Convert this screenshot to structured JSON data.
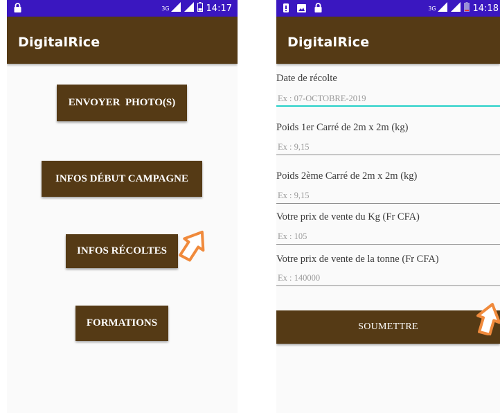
{
  "left_screen": {
    "status": {
      "network": "3G",
      "time": "14:17"
    },
    "app_title": "DigitalRice",
    "buttons": [
      {
        "label": "ENVOYER  PHOTO(S)"
      },
      {
        "label": "INFOS DÉBUT CAMPAGNE"
      },
      {
        "label": "INFOS RÉCOLTES"
      },
      {
        "label": "FORMATIONS"
      }
    ]
  },
  "right_screen": {
    "status": {
      "network": "3G",
      "time": "14:18"
    },
    "app_title": "DigitalRice",
    "fields": [
      {
        "label": "Date de récolte",
        "placeholder": "Ex : 07-OCTOBRE-2019"
      },
      {
        "label": "Poids 1er Carré de 2m x 2m (kg)",
        "placeholder": "Ex : 9,15"
      },
      {
        "label": "Poids 2ème Carré de 2m x 2m (kg)",
        "placeholder": "Ex : 9,15"
      },
      {
        "label": "Votre prix de vente du Kg (Fr CFA)",
        "placeholder": "Ex : 105"
      },
      {
        "label": "Votre prix de vente de la tonne (Fr CFA)",
        "placeholder": "Ex : 140000"
      }
    ],
    "submit_label": "SOUMETTRE"
  },
  "colors": {
    "status_bar": "#3a17c0",
    "app_bar": "#553a15",
    "accent_underline": "#25d0c8",
    "arrow_annotation": "#f08a3c"
  }
}
